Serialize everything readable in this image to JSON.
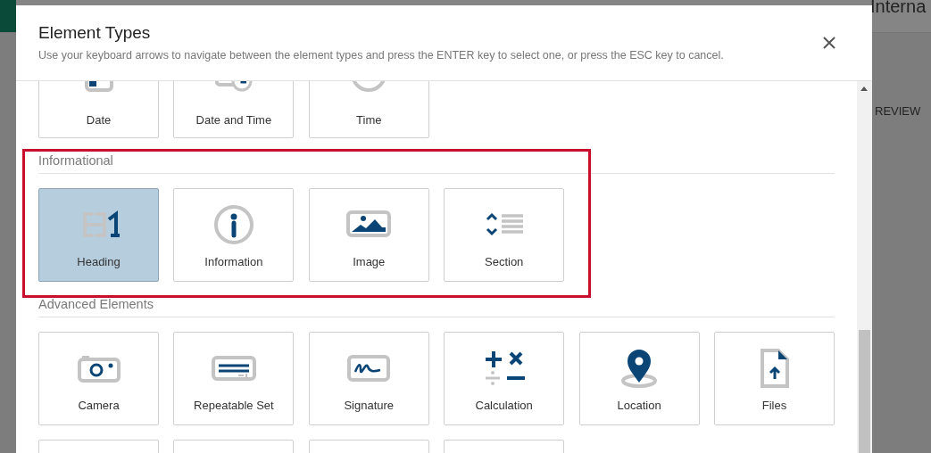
{
  "background": {
    "workspace": "Interna",
    "column_header": "REVIEW"
  },
  "dialog": {
    "title": "Element Types",
    "instructions": "Use your keyboard arrows to navigate between the element types and press the ENTER key to select one, or press the ESC key to cancel.",
    "sections": [
      {
        "tiles": [
          {
            "label": "Date",
            "kind": "date",
            "selected": false
          },
          {
            "label": "Date and Time",
            "kind": "datetime",
            "selected": false
          },
          {
            "label": "Time",
            "kind": "time",
            "selected": false
          }
        ]
      },
      {
        "title": "Informational",
        "highlighted": true,
        "tiles": [
          {
            "label": "Heading",
            "kind": "heading",
            "selected": true
          },
          {
            "label": "Information",
            "kind": "information",
            "selected": false
          },
          {
            "label": "Image",
            "kind": "image",
            "selected": false
          },
          {
            "label": "Section",
            "kind": "section",
            "selected": false
          }
        ]
      },
      {
        "title": "Advanced Elements",
        "tiles": [
          {
            "label": "Camera",
            "kind": "camera",
            "selected": false
          },
          {
            "label": "Repeatable Set",
            "kind": "repeatable",
            "selected": false
          },
          {
            "label": "Signature",
            "kind": "signature",
            "selected": false
          },
          {
            "label": "Calculation",
            "kind": "calculation",
            "selected": false
          },
          {
            "label": "Location",
            "kind": "location",
            "selected": false
          },
          {
            "label": "Files",
            "kind": "files",
            "selected": false
          },
          {
            "selected": false
          },
          {
            "selected": false
          },
          {
            "selected": false
          },
          {
            "selected": false
          }
        ]
      }
    ]
  }
}
